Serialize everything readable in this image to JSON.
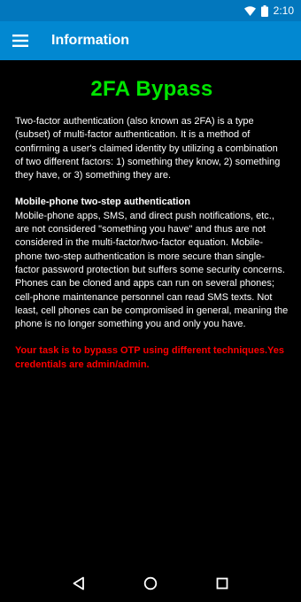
{
  "status_bar": {
    "time": "2:10",
    "icons": [
      "wifi-icon",
      "battery-icon"
    ]
  },
  "app_bar": {
    "title": "Information",
    "menu_icon": "menu-icon"
  },
  "content": {
    "heading": "2FA Bypass",
    "intro": "Two-factor authentication (also known as 2FA) is a type (subset) of multi-factor authentication. It is a method of confirming a user's claimed identity by utilizing a combination of two different factors: 1) something they know, 2) something they have, or 3) something they are.",
    "section_heading": "Mobile-phone two-step authentication",
    "section_body": "Mobile-phone apps, SMS, and direct push notifications, etc., are not considered \"something you have\" and thus are not considered in the multi-factor/two-factor equation. Mobile-phone two-step authentication is more secure than single-factor password protection but suffers some security concerns. Phones can be cloned and apps can run on several phones; cell-phone maintenance personnel can read SMS texts. Not least, cell phones can be compromised in general, meaning the phone is no longer something you and only you have.",
    "task": "Your task is to bypass OTP using different techniques.Yes credentials are admin/admin."
  },
  "nav_bar": {
    "buttons": [
      "back-icon",
      "home-icon",
      "recents-icon"
    ]
  },
  "colors": {
    "status_bar": "#0277bd",
    "app_bar": "#0288d1",
    "heading": "#00e600",
    "task": "#ff0000",
    "background": "#000000"
  }
}
